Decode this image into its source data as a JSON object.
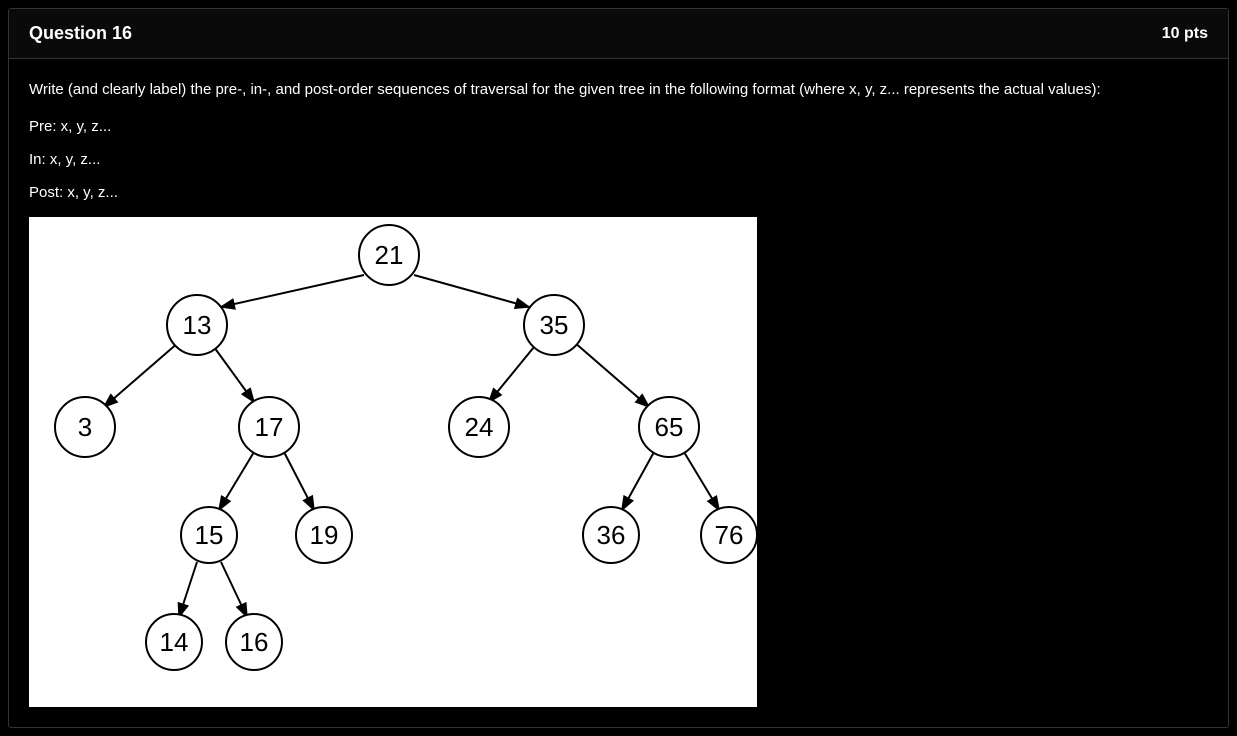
{
  "header": {
    "title": "Question 16",
    "points": "10 pts"
  },
  "body": {
    "instruction": "Write (and clearly label) the pre-, in-, and post-order sequences of traversal for the given tree in the following format (where x, y, z... represents the actual values):",
    "format_pre": "Pre:  x, y, z...",
    "format_in": "In:  x, y, z...",
    "format_post": "Post:  x, y, z..."
  },
  "tree": {
    "nodes": {
      "n21": "21",
      "n13": "13",
      "n35": "35",
      "n3": "3",
      "n17": "17",
      "n24": "24",
      "n65": "65",
      "n15": "15",
      "n19": "19",
      "n36": "36",
      "n76": "76",
      "n14": "14",
      "n16": "16"
    }
  }
}
